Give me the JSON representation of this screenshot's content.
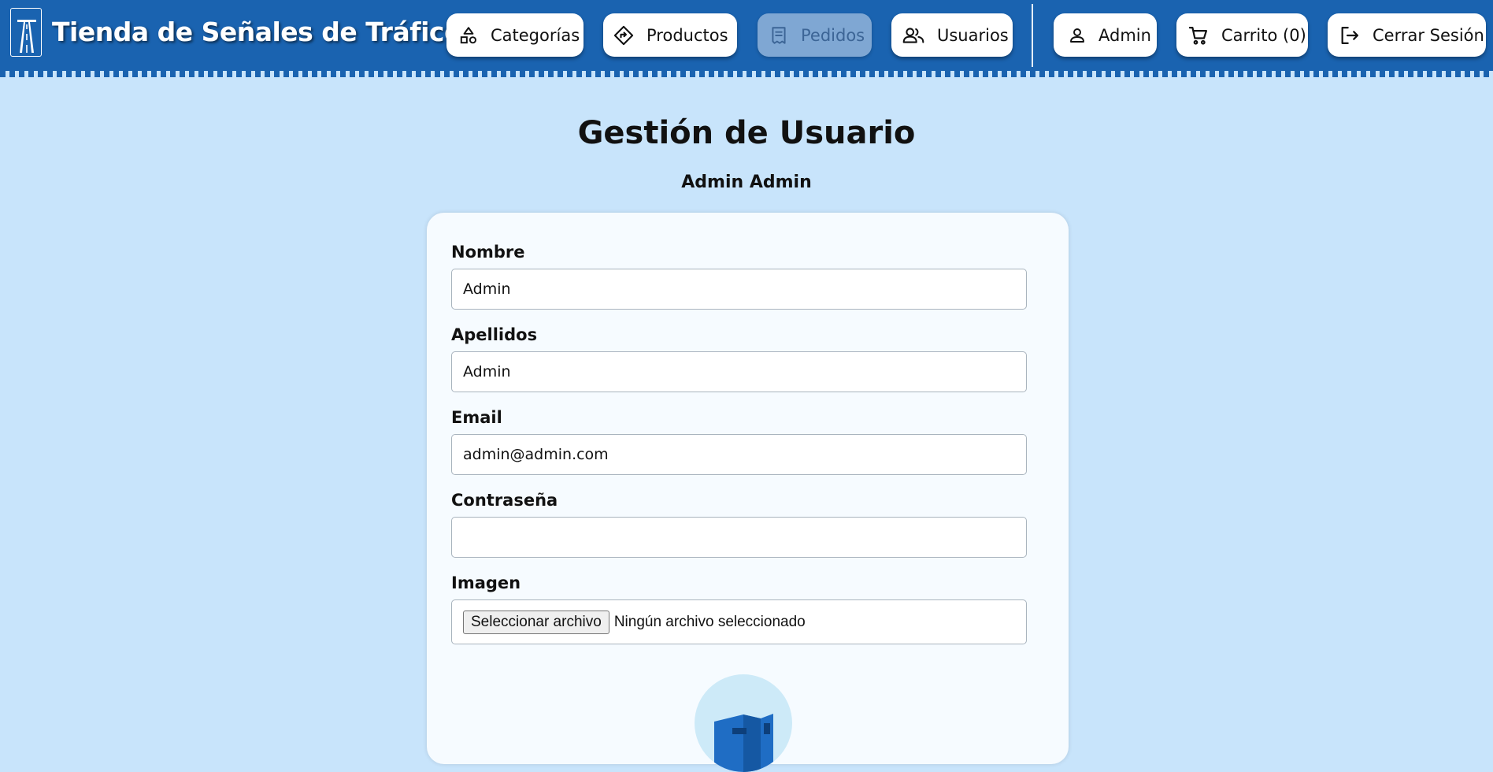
{
  "header": {
    "title": "Tienda de Señales de Tráfico",
    "logo_icon": "highway-sign-icon",
    "nav": [
      {
        "label": "Categorías",
        "icon": "shapes-icon"
      },
      {
        "label": "Productos",
        "icon": "diamond-sign-icon"
      },
      {
        "label": "Pedidos",
        "icon": "receipt-icon",
        "disabled": true
      },
      {
        "label": "Usuarios",
        "icon": "users-icon"
      }
    ],
    "user": {
      "label": "Admin",
      "icon": "user-icon"
    },
    "cart": {
      "label": "Carrito (0)",
      "icon": "cart-icon"
    },
    "logout": {
      "label": "Cerrar Sesión",
      "icon": "logout-icon"
    }
  },
  "main": {
    "title": "Gestión de Usuario",
    "user_name": "Admin Admin",
    "form": {
      "nombre": {
        "label": "Nombre",
        "value": "Admin"
      },
      "apellidos": {
        "label": "Apellidos",
        "value": "Admin"
      },
      "email": {
        "label": "Email",
        "value": "admin@admin.com"
      },
      "password": {
        "label": "Contraseña",
        "value": ""
      },
      "imagen": {
        "label": "Imagen",
        "button_label": "Seleccionar archivo",
        "status": "Ningún archivo seleccionado"
      },
      "avatar_icon": "avatar-image"
    }
  },
  "colors": {
    "header": "#1a63b0",
    "background": "#c8e4fb",
    "card": "#f6fbff",
    "disabled_button": "#7fa7d3"
  }
}
